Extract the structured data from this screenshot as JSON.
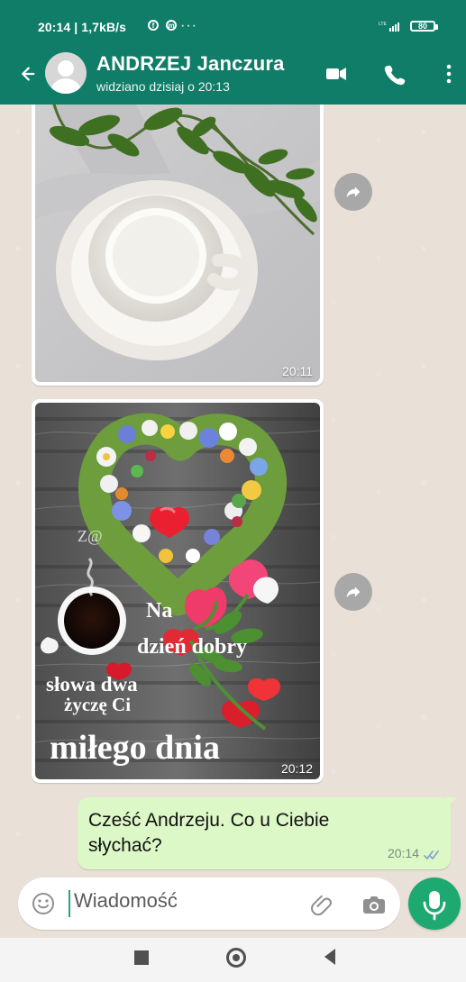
{
  "status_bar": {
    "left_text": "20:14 | 1,7kB/s",
    "more": "···",
    "signal_label": "LTE",
    "battery": "80"
  },
  "header": {
    "contact_name": "ANDRZEJ Janczura",
    "last_seen": "widziano dzisiaj o 20:13"
  },
  "chat": {
    "media": [
      {
        "time": "20:11",
        "kind": "photo"
      },
      {
        "time": "20:12",
        "kind": "greeting-image",
        "overlay_lines": [
          "Na",
          "dzień dobry",
          "słowa dwa",
          "życzę Ci",
          "miłego dnia"
        ],
        "signature": "Z@"
      }
    ],
    "message": {
      "text": "Cześć Andrzeju. Co u Ciebie słychać?",
      "time": "20:14"
    }
  },
  "composer": {
    "placeholder": "Wiadomość"
  },
  "colors": {
    "primary": "#0f7d68",
    "accent": "#1ea971",
    "bubble": "#dcf8c6"
  },
  "icons": [
    "back-icon",
    "video-call-icon",
    "phone-icon",
    "more-icon",
    "share-icon",
    "emoji-icon",
    "attach-icon",
    "camera-icon",
    "mic-icon"
  ]
}
